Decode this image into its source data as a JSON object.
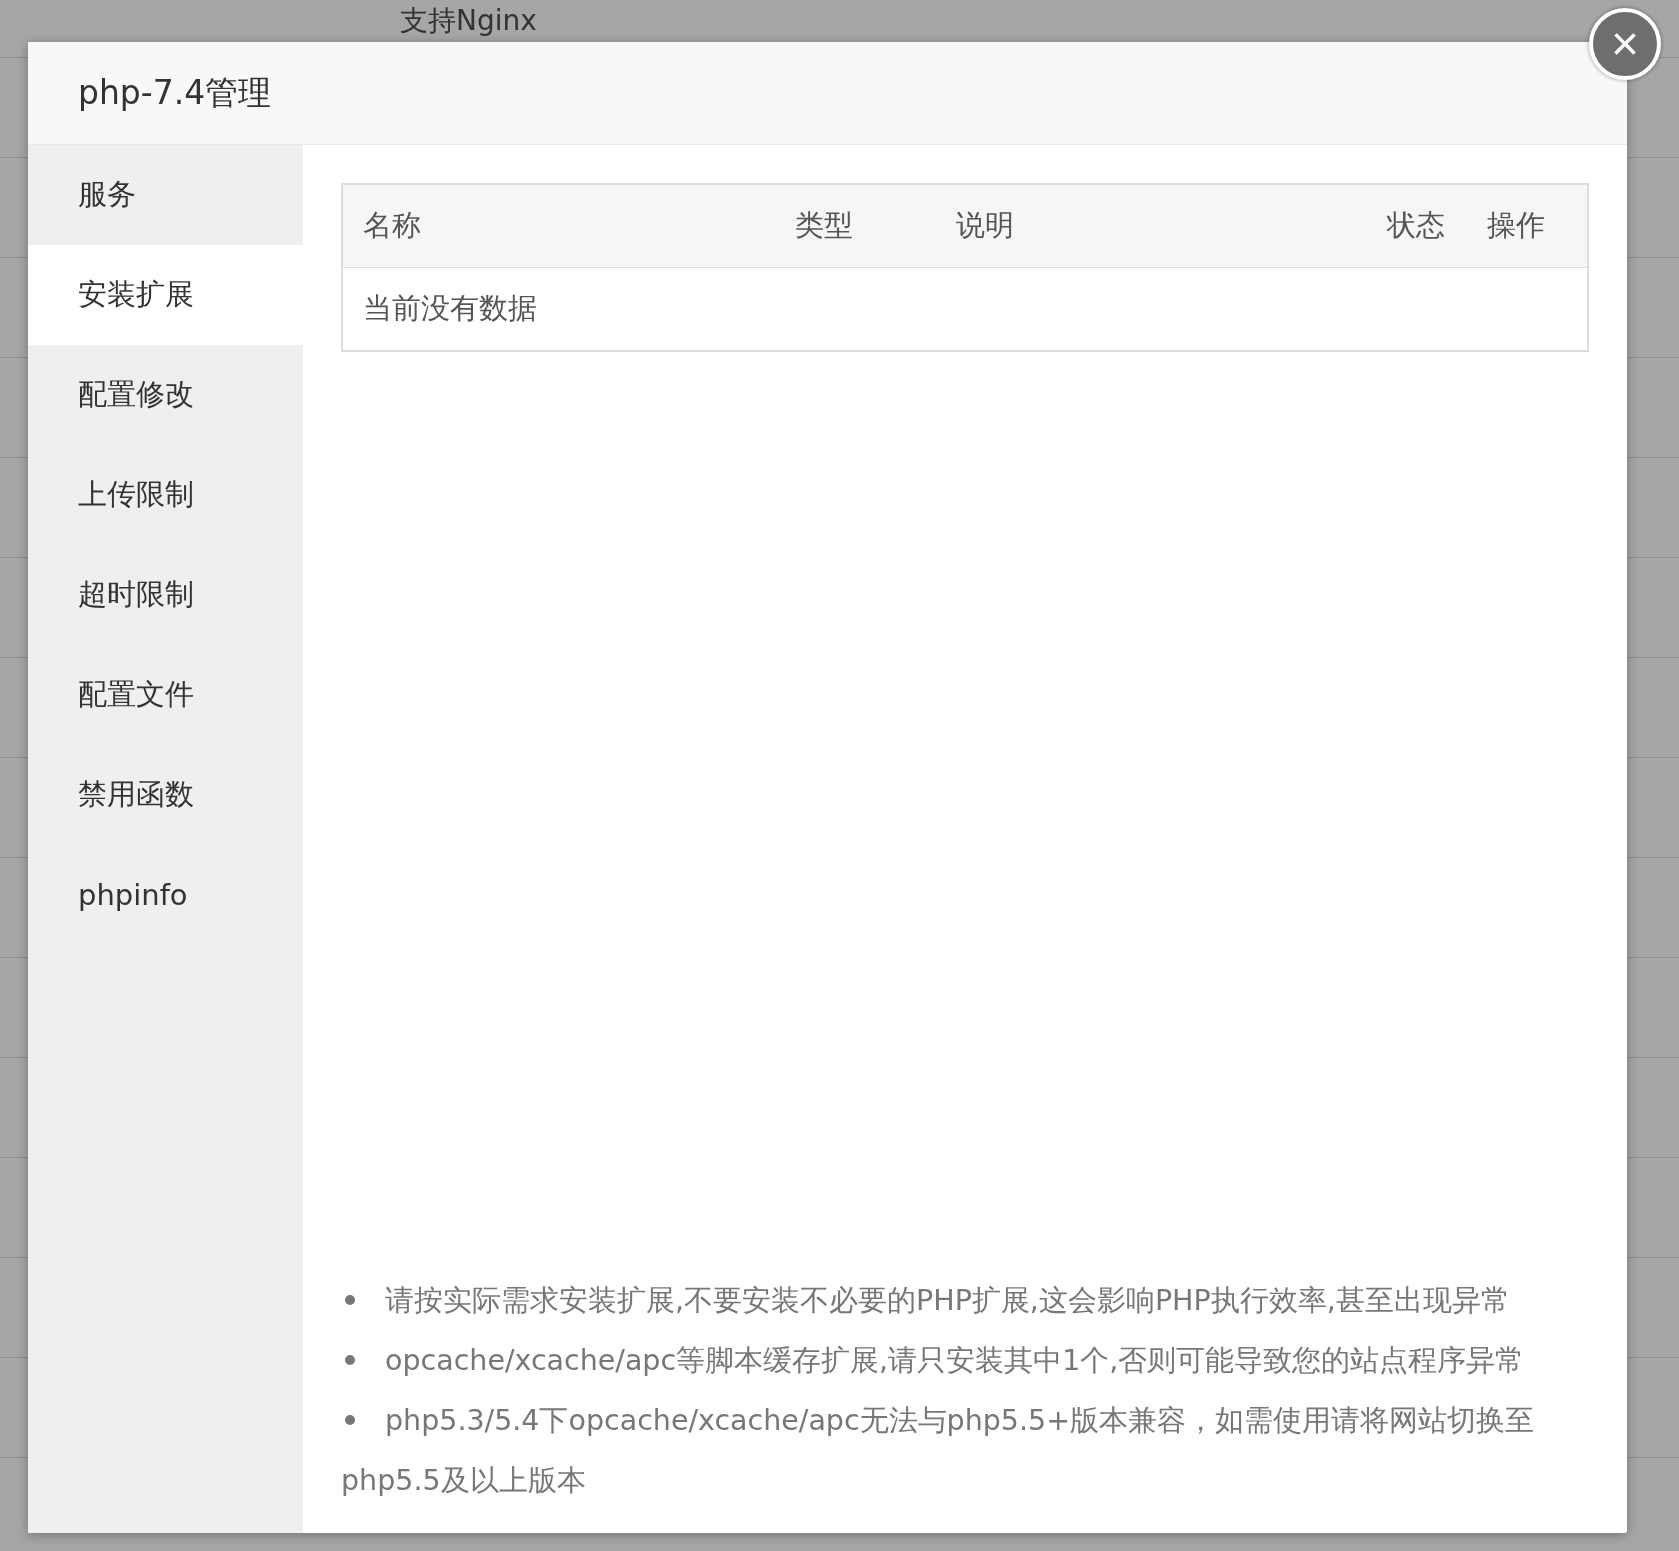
{
  "background_page": {
    "text": "支持Nginx"
  },
  "dialog": {
    "title": "php-7.4管理",
    "close_button": {
      "label": "×"
    },
    "sidebar": {
      "items": [
        {
          "label": "服务",
          "selected": false
        },
        {
          "label": "安装扩展",
          "selected": true
        },
        {
          "label": "配置修改",
          "selected": false
        },
        {
          "label": "上传限制",
          "selected": false
        },
        {
          "label": "超时限制",
          "selected": false
        },
        {
          "label": "配置文件",
          "selected": false
        },
        {
          "label": "禁用函数",
          "selected": false
        },
        {
          "label": "phpinfo",
          "selected": false
        }
      ]
    },
    "table": {
      "columns": [
        "名称",
        "类型",
        "说明",
        "状态",
        "操作"
      ],
      "empty_text": "当前没有数据"
    },
    "notes": [
      "请按实际需求安装扩展,不要安装不必要的PHP扩展,这会影响PHP执行效率,甚至出现异常",
      "opcache/xcache/apc等脚本缓存扩展,请只安装其中1个,否则可能导致您的站点程序异常",
      "php5.3/5.4下opcache/xcache/apc无法与php5.5+版本兼容，如需使用请将网站切换至php5.5及以上版本"
    ]
  }
}
